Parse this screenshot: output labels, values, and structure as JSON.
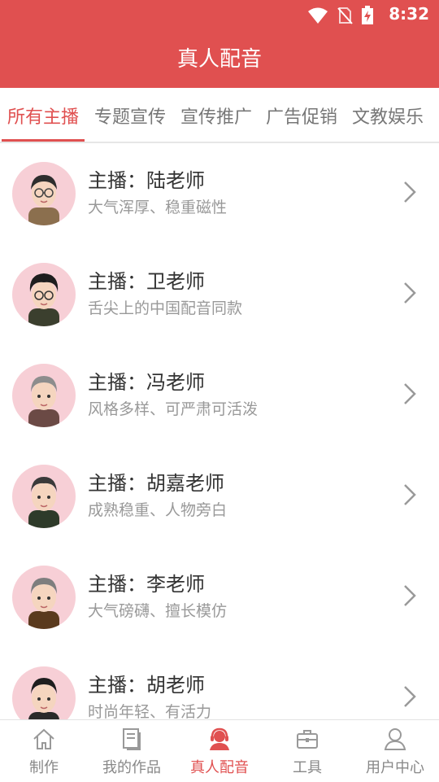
{
  "status": {
    "time": "8:32",
    "icons": [
      "wifi-icon",
      "no-sim-icon",
      "battery-charging-icon"
    ]
  },
  "header": {
    "title": "真人配音",
    "color": "#e05050"
  },
  "tabs": [
    {
      "label": "所有主播",
      "active": true
    },
    {
      "label": "专题宣传",
      "active": false
    },
    {
      "label": "宣传推广",
      "active": false
    },
    {
      "label": "广告促销",
      "active": false
    },
    {
      "label": "文教娱乐",
      "active": false
    }
  ],
  "anchors": [
    {
      "name": "主播：陆老师",
      "desc": "大气浑厚、稳重磁性"
    },
    {
      "name": "主播：卫老师",
      "desc": "舌尖上的中国配音同款"
    },
    {
      "name": "主播：冯老师",
      "desc": "风格多样、可严肃可活泼"
    },
    {
      "name": "主播：胡嘉老师",
      "desc": "成熟稳重、人物旁白"
    },
    {
      "name": "主播：李老师",
      "desc": "大气磅礴、擅长模仿"
    },
    {
      "name": "主播：胡老师",
      "desc": "时尚年轻、有活力"
    }
  ],
  "bottom_nav": [
    {
      "label": "制作",
      "icon": "home-icon",
      "active": false
    },
    {
      "label": "我的作品",
      "icon": "document-icon",
      "active": false
    },
    {
      "label": "真人配音",
      "icon": "headset-person-icon",
      "active": true
    },
    {
      "label": "工具",
      "icon": "toolbox-icon",
      "active": false
    },
    {
      "label": "用户中心",
      "icon": "user-icon",
      "active": false
    }
  ]
}
